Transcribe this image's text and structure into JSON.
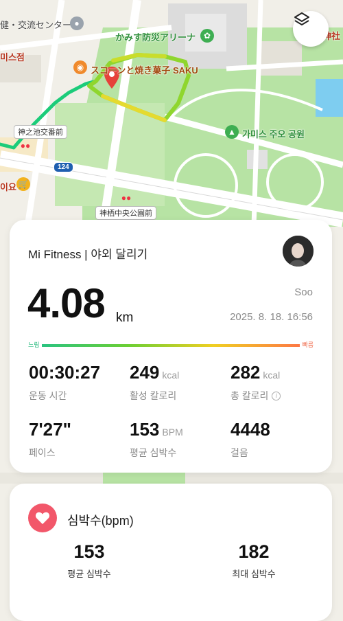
{
  "map": {
    "labels": {
      "welfare_center": "健・交流センター",
      "arena": "かみす防災アリーナ",
      "shop_top_left": "미스점",
      "bakery": "スコーンと焼き菓子 SAKU",
      "park_kr": "가미스 주오 공원",
      "station1": "神之池交番前",
      "route_number": "124",
      "shop_left": "이요",
      "station2": "神栖中央公園前",
      "top_right": "神社",
      "mid_right": "社"
    },
    "icons": [
      "layers-icon"
    ]
  },
  "summary": {
    "app_title": "Mi Fitness | 야외 달리기",
    "user": "Soo",
    "datetime": "2025. 8. 18. 16:56",
    "distance": "4.08",
    "distance_unit": "km",
    "pace_bar": {
      "slow_label": "느림",
      "fast_label": "빠름"
    },
    "stats": [
      {
        "value": "00:30:27",
        "unit": "",
        "label": "운동 시간"
      },
      {
        "value": "249",
        "unit": "kcal",
        "label": "활성 칼로리"
      },
      {
        "value": "282",
        "unit": "kcal",
        "label": "총 칼로리"
      },
      {
        "value": "7'27\"",
        "unit": "",
        "label": "페이스"
      },
      {
        "value": "153",
        "unit": "BPM",
        "label": "평균 심박수"
      },
      {
        "value": "4448",
        "unit": "",
        "label": "걸음"
      }
    ]
  },
  "heart_rate": {
    "title": "심박수(bpm)",
    "avg_value": "153",
    "avg_label": "평균 심박수",
    "max_value": "182",
    "max_label": "최대 심박수"
  }
}
